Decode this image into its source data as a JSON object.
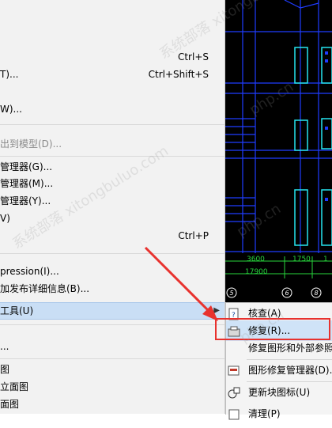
{
  "menu": {
    "items": [
      {
        "label": "",
        "shortcut": "Ctrl+S"
      },
      {
        "label": "T)...",
        "shortcut": "Ctrl+Shift+S"
      },
      {
        "label": "W)...",
        "shortcut": ""
      },
      {
        "label": "出到模型(D)...",
        "shortcut": ""
      },
      {
        "label": "管理器(G)...",
        "shortcut": ""
      },
      {
        "label": "管理器(M)...",
        "shortcut": ""
      },
      {
        "label": "管理器(Y)...",
        "shortcut": ""
      },
      {
        "label": "V)",
        "shortcut": ""
      },
      {
        "label": "",
        "shortcut": "Ctrl+P"
      },
      {
        "label": "pression(I)...",
        "shortcut": ""
      },
      {
        "label": "加发布详细信息(B)...",
        "shortcut": ""
      },
      {
        "label": "工具(U)",
        "shortcut": ""
      },
      {
        "label": "...",
        "shortcut": ""
      },
      {
        "label": "图",
        "shortcut": ""
      },
      {
        "label": "立面图",
        "shortcut": ""
      },
      {
        "label": "面图",
        "shortcut": ""
      }
    ]
  },
  "submenu": {
    "items": [
      {
        "label": "核查(A)"
      },
      {
        "label": "修复(R)..."
      },
      {
        "label": "修复图形和外部参照"
      },
      {
        "label": "图形修复管理器(D)..."
      },
      {
        "label": "更新块图标(U)"
      },
      {
        "label": "清理(P)"
      }
    ]
  },
  "cad": {
    "dim_labels": [
      "3600",
      "1750",
      "1",
      "17900"
    ],
    "axis_labels": [
      "5",
      "6",
      "8"
    ]
  },
  "watermark": {
    "texts": [
      "系统部落 xitongbuluo.com",
      "php.cn",
      "系统部落 xitongbuluo.com",
      "php.cn",
      "php.cn"
    ]
  },
  "colors": {
    "menu_bg": "#f2f2f2",
    "highlight": "#c9def5",
    "cad_bg": "#000000",
    "cad_blue": "#1f3cff",
    "cad_cyan": "#25e6f0",
    "cad_green": "#27d63c",
    "annotation_red": "#e8322e"
  }
}
